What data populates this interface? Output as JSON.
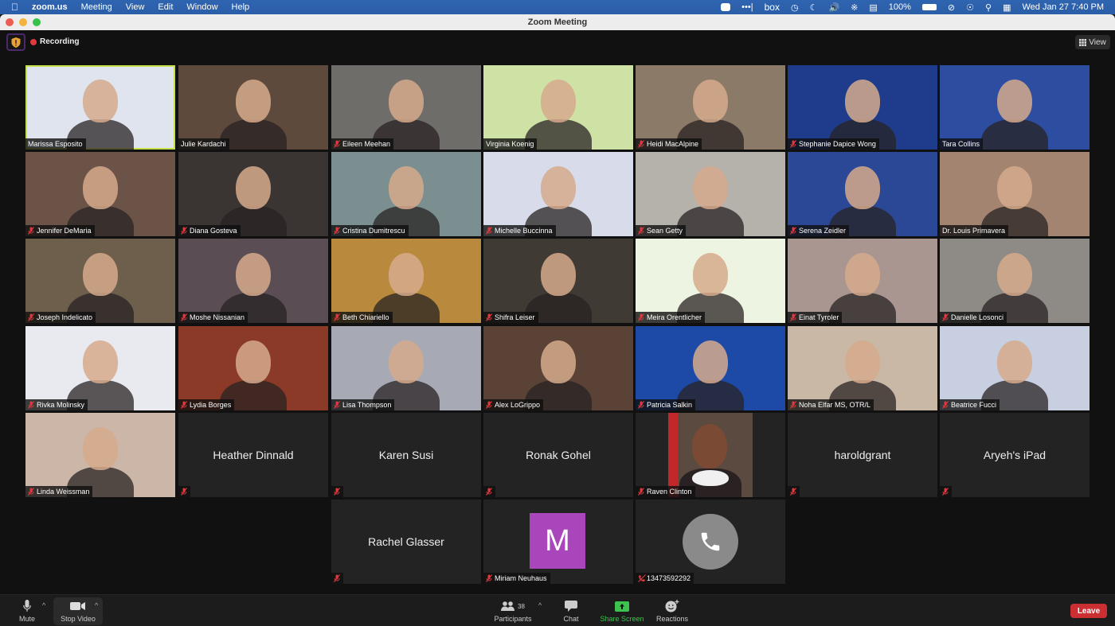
{
  "menubar": {
    "apple": "",
    "app": "zoom.us",
    "items": [
      "Meeting",
      "View",
      "Edit",
      "Window",
      "Help"
    ],
    "battery": "100%",
    "box": "box",
    "datetime": "Wed Jan 27  7:40 PM"
  },
  "window": {
    "title": "Zoom Meeting"
  },
  "meeting": {
    "recording_label": "Recording",
    "view_label": "View"
  },
  "participants": [
    {
      "name": "Marissa Esposito",
      "type": "video",
      "muted": false,
      "active": true,
      "bg": "#dfe4ee"
    },
    {
      "name": "Julie Kardachi",
      "type": "video",
      "muted": false,
      "bg": "#5e4a3c"
    },
    {
      "name": "Eileen Meehan",
      "type": "video",
      "muted": true,
      "bg": "#6f6d69"
    },
    {
      "name": "Virginia Koenig",
      "type": "video",
      "muted": false,
      "bg": "#cfe2a6"
    },
    {
      "name": "Heidi MacAlpine",
      "type": "video",
      "muted": true,
      "bg": "#8c7a68"
    },
    {
      "name": "Stephanie Dapice Wong",
      "type": "video",
      "muted": true,
      "bg": "#1f3c8c"
    },
    {
      "name": "Tara Collins",
      "type": "video",
      "muted": false,
      "bg": "#2d4ea0"
    },
    {
      "name": "Jennifer DeMaria",
      "type": "video",
      "muted": true,
      "bg": "#6b5348"
    },
    {
      "name": "Diana Gosteva",
      "type": "video",
      "muted": true,
      "bg": "#3a3532"
    },
    {
      "name": "Cristina Dumitrescu",
      "type": "video",
      "muted": true,
      "bg": "#7b8f90"
    },
    {
      "name": "Michelle Buccinna",
      "type": "video",
      "muted": true,
      "bg": "#d8dcea"
    },
    {
      "name": "Sean Getty",
      "type": "video",
      "muted": true,
      "bg": "#b5b1ab"
    },
    {
      "name": "Serena Zeidler",
      "type": "video",
      "muted": true,
      "bg": "#2a4896"
    },
    {
      "name": "Dr. Louis Primavera",
      "type": "video",
      "muted": false,
      "bg": "#a38470"
    },
    {
      "name": "Joseph Indelicato",
      "type": "video",
      "muted": true,
      "bg": "#6e5e4c"
    },
    {
      "name": "Moshe Nissanian",
      "type": "video",
      "muted": true,
      "bg": "#5a4e54"
    },
    {
      "name": "Beth Chiariello",
      "type": "video",
      "muted": true,
      "bg": "#b98a3d"
    },
    {
      "name": "Shifra Leiser",
      "type": "video",
      "muted": true,
      "bg": "#3f3a33"
    },
    {
      "name": "Meira Orentlicher",
      "type": "video",
      "muted": true,
      "bg": "#eef4e2"
    },
    {
      "name": "Einat Tyroler",
      "type": "video",
      "muted": true,
      "bg": "#a99690"
    },
    {
      "name": "Danielle Losonci",
      "type": "video",
      "muted": true,
      "bg": "#8e8a86"
    },
    {
      "name": "Rivka Molinsky",
      "type": "video",
      "muted": true,
      "bg": "#e9eaf0"
    },
    {
      "name": "Lydia Borges",
      "type": "video",
      "muted": true,
      "bg": "#8a3a26"
    },
    {
      "name": "Lisa Thompson",
      "type": "video",
      "muted": true,
      "bg": "#a7a9b5"
    },
    {
      "name": "Alex LoGrippo",
      "type": "video",
      "muted": true,
      "bg": "#5a4236"
    },
    {
      "name": "Patricia Salkin",
      "type": "video",
      "muted": true,
      "bg": "#1c4aa6"
    },
    {
      "name": "Noha Elfar MS, OTR/L",
      "type": "video",
      "muted": true,
      "bg": "#c9b8a6"
    },
    {
      "name": "Beatrice Fucci",
      "type": "video",
      "muted": true,
      "bg": "#c8cfe0"
    },
    {
      "name": "Linda Weissman",
      "type": "video",
      "muted": true,
      "bg": "#cbb6a8"
    },
    {
      "name": "Heather Dinnald",
      "type": "name",
      "muted": true
    },
    {
      "name": "Karen Susi",
      "type": "name",
      "muted": true
    },
    {
      "name": "Ronak Gohel",
      "type": "name",
      "muted": true
    },
    {
      "name": "Raven Clinton",
      "type": "photo",
      "muted": true
    },
    {
      "name": "haroldgrant",
      "type": "name",
      "muted": true
    },
    {
      "name": "Aryeh's iPad",
      "type": "name",
      "muted": true
    },
    {
      "name": "Rachel Glasser",
      "type": "name",
      "muted": true
    },
    {
      "name": "Miriam Neuhaus",
      "type": "avatar",
      "initial": "M",
      "muted": true,
      "avatar_color": "#a946bb"
    },
    {
      "name": "13473592292",
      "type": "phone",
      "muted": true
    }
  ],
  "toolbar": {
    "mute": "Mute",
    "stop_video": "Stop Video",
    "participants": "Participants",
    "participant_count": "38",
    "chat": "Chat",
    "share_screen": "Share Screen",
    "reactions": "Reactions",
    "leave": "Leave"
  },
  "colors": {
    "share_green": "#3cc24d",
    "leave_red": "#cc2f31",
    "active_speaker": "#c6e24a",
    "mute_red": "#e0393e"
  }
}
